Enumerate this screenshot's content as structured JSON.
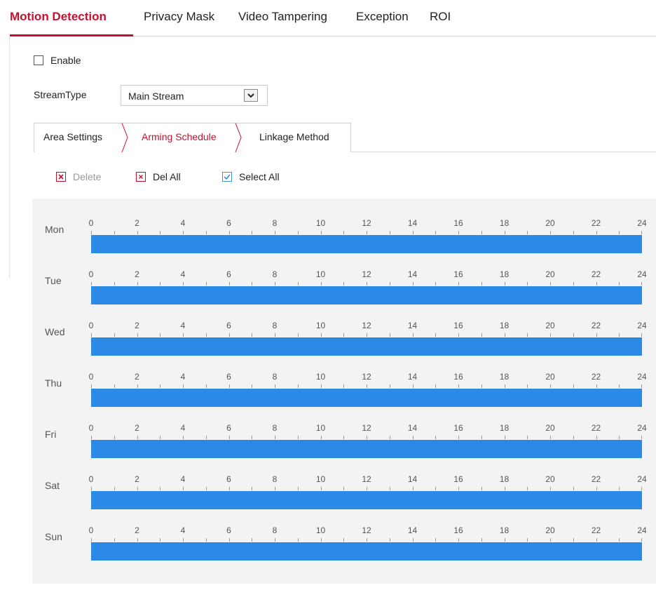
{
  "top_tabs": [
    {
      "label": "Motion Detection",
      "active": true
    },
    {
      "label": "Privacy Mask",
      "active": false
    },
    {
      "label": "Video Tampering",
      "active": false
    },
    {
      "label": "Exception",
      "active": false
    },
    {
      "label": "ROI",
      "active": false
    }
  ],
  "enable": {
    "label": "Enable",
    "checked": false
  },
  "stream_type": {
    "label": "StreamType",
    "value": "Main Stream"
  },
  "sub_tabs": [
    {
      "label": "Area Settings",
      "active": false
    },
    {
      "label": "Arming Schedule",
      "active": true
    },
    {
      "label": "Linkage Method",
      "active": false
    }
  ],
  "toolbar": {
    "delete_label": "Delete",
    "del_all_label": "Del All",
    "select_all_label": "Select All"
  },
  "schedule": {
    "hours": [
      "0",
      "2",
      "4",
      "6",
      "8",
      "10",
      "12",
      "14",
      "16",
      "18",
      "20",
      "22",
      "24"
    ],
    "days": [
      {
        "label": "Mon",
        "start": 0,
        "end": 24
      },
      {
        "label": "Tue",
        "start": 0,
        "end": 24
      },
      {
        "label": "Wed",
        "start": 0,
        "end": 24
      },
      {
        "label": "Thu",
        "start": 0,
        "end": 24
      },
      {
        "label": "Fri",
        "start": 0,
        "end": 24
      },
      {
        "label": "Sat",
        "start": 0,
        "end": 24
      },
      {
        "label": "Sun",
        "start": 0,
        "end": 24
      }
    ]
  },
  "colors": {
    "accent": "#c8102e",
    "schedule_bar": "#2b8ae6",
    "panel_bg": "#f3f3f3"
  }
}
